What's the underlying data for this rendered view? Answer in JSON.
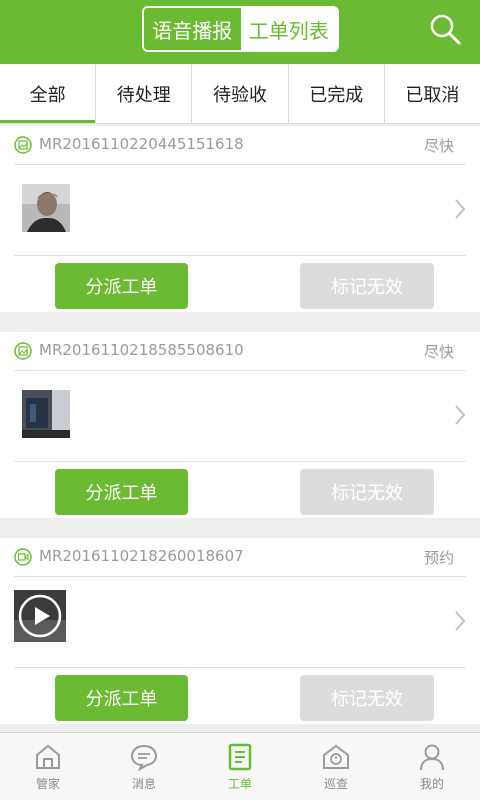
{
  "header": {
    "segment_left": "语音播报",
    "segment_right": "工单列表",
    "search_icon": "search-icon"
  },
  "tabs": [
    {
      "label": "全部",
      "active": true
    },
    {
      "label": "待处理",
      "active": false
    },
    {
      "label": "待验收",
      "active": false
    },
    {
      "label": "已完成",
      "active": false
    },
    {
      "label": "已取消",
      "active": false
    }
  ],
  "orders": [
    {
      "id": "MR2016110220445151618",
      "priority": "尽快",
      "type_icon": "image-icon",
      "media": "photo",
      "assign_label": "分派工单",
      "invalid_label": "标记无效"
    },
    {
      "id": "MR2016110218585508610",
      "priority": "尽快",
      "type_icon": "image-icon",
      "media": "photo",
      "assign_label": "分派工单",
      "invalid_label": "标记无效"
    },
    {
      "id": "MR2016110218260018607",
      "priority": "预约",
      "type_icon": "video-icon",
      "media": "video",
      "assign_label": "分派工单",
      "invalid_label": "标记无效"
    }
  ],
  "bottom_nav": [
    {
      "label": "管家",
      "icon": "home-icon",
      "active": false
    },
    {
      "label": "消息",
      "icon": "message-icon",
      "active": false
    },
    {
      "label": "工单",
      "icon": "workorder-icon",
      "active": true
    },
    {
      "label": "巡查",
      "icon": "patrol-icon",
      "active": false
    },
    {
      "label": "我的",
      "icon": "profile-icon",
      "active": false
    }
  ],
  "colors": {
    "accent": "#6aba33",
    "disabled": "#dcdcdc",
    "muted_text": "#9a9a9a"
  }
}
